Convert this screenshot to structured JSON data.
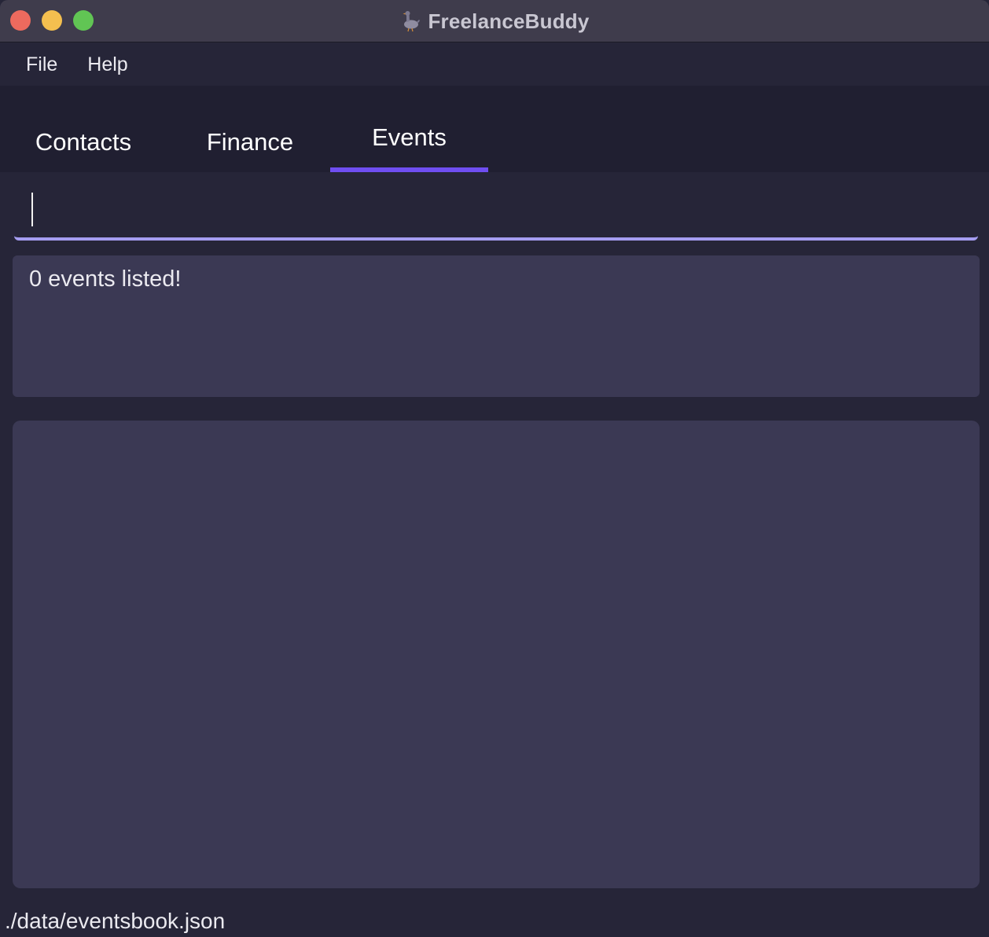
{
  "window": {
    "title": "FreelanceBuddy",
    "app_icon": "duck-icon",
    "traffic_lights": {
      "close_color": "#ec6a5e",
      "minimize_color": "#f4bf4f",
      "maximize_color": "#61c554"
    }
  },
  "menu": {
    "items": [
      {
        "label": "File"
      },
      {
        "label": "Help"
      }
    ]
  },
  "tabs": {
    "items": [
      {
        "label": "Contacts",
        "selected": false
      },
      {
        "label": "Finance",
        "selected": false
      },
      {
        "label": "Events",
        "selected": true
      }
    ],
    "indicator_color": "#6f4ef1"
  },
  "command": {
    "value": "",
    "placeholder": "",
    "underline_color": "#a59df1"
  },
  "result": {
    "message": "0 events listed!"
  },
  "event_list": {
    "items": []
  },
  "status": {
    "file_path": "./data/eventsbook.json"
  },
  "colors": {
    "background": "#262538",
    "panel": "#3b3954",
    "titlebar": "#3f3c4c",
    "tabbar": "#201f31",
    "text": "#ebeaf0"
  }
}
